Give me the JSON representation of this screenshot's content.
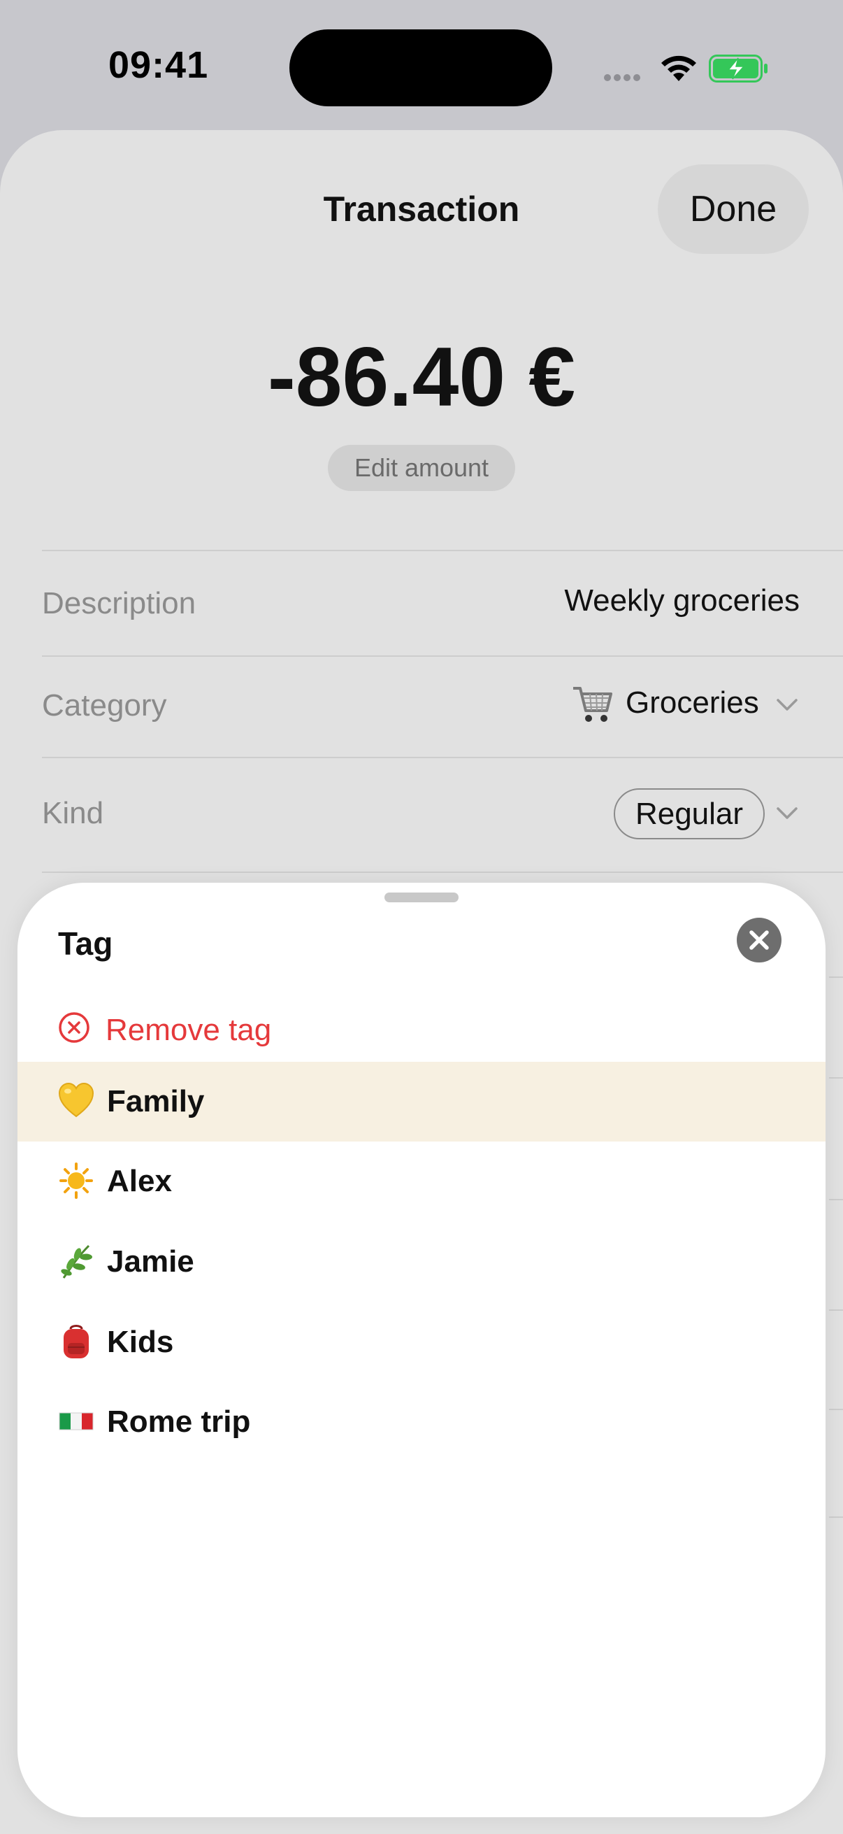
{
  "status_bar": {
    "time": "09:41"
  },
  "nav": {
    "title": "Transaction",
    "done_label": "Done"
  },
  "amount": {
    "value": "-86.40 €",
    "edit_label": "Edit amount"
  },
  "fields": {
    "description": {
      "label": "Description",
      "value": "Weekly groceries"
    },
    "category": {
      "label": "Category",
      "value": "Groceries",
      "icon": "shopping-cart-icon"
    },
    "kind": {
      "label": "Kind",
      "value": "Regular"
    }
  },
  "tag_sheet": {
    "title": "Tag",
    "remove_label": "Remove tag",
    "tags": [
      {
        "label": "Family",
        "icon": "yellow-heart-icon",
        "selected": true
      },
      {
        "label": "Alex",
        "icon": "sun-icon",
        "selected": false
      },
      {
        "label": "Jamie",
        "icon": "herb-icon",
        "selected": false
      },
      {
        "label": "Kids",
        "icon": "backpack-icon",
        "selected": false
      },
      {
        "label": "Rome trip",
        "icon": "italy-flag-icon",
        "selected": false
      }
    ]
  },
  "colors": {
    "destructive": "#e5393b",
    "selected_row": "#f7f0e1",
    "battery_green": "#34c759"
  }
}
